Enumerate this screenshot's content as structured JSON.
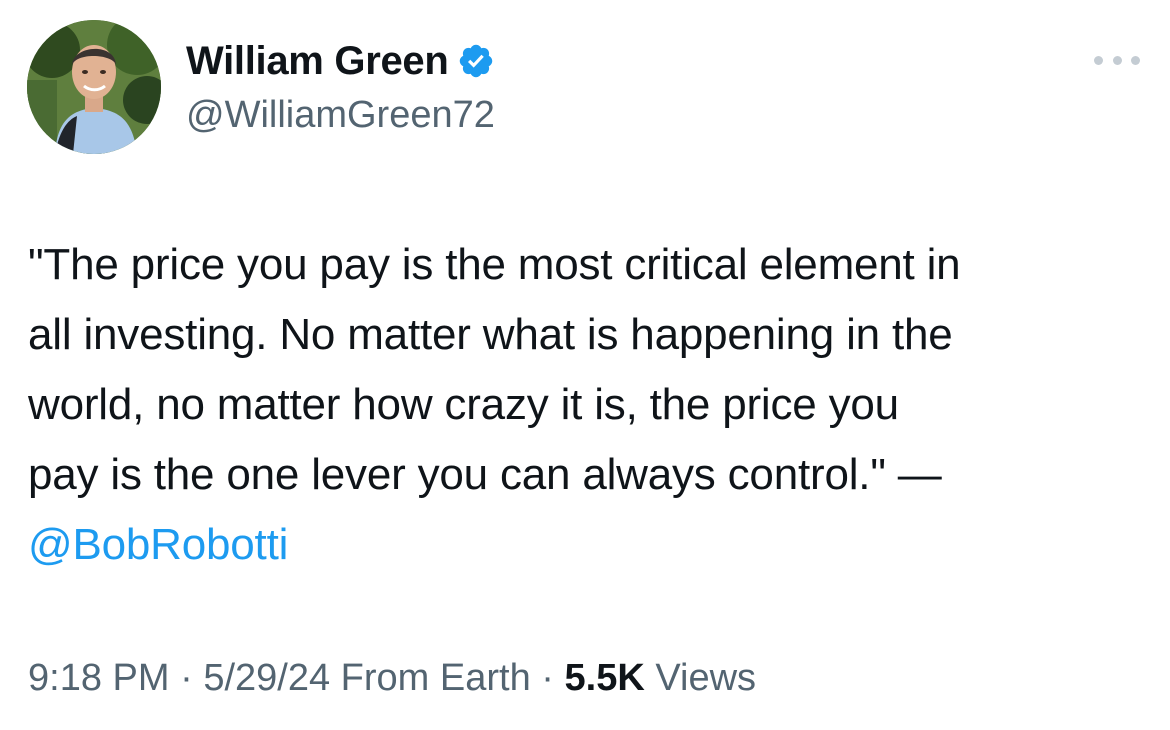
{
  "author": {
    "display_name": "William Green",
    "handle": "@WilliamGreen72",
    "verified": true,
    "avatar_icon": "avatar-photo"
  },
  "tweet": {
    "lines": [
      "\"The price you pay is the most critical element in",
      "all investing. No matter what is happening in the",
      "world, no matter how crazy it is, the price you",
      "pay is the one lever you can always control.\" —"
    ],
    "mention": "@BobRobotti"
  },
  "meta": {
    "time": "9:18 PM",
    "sep1": " · ",
    "date": "5/29/24",
    "source": "From Earth",
    "sep2": " · ",
    "views_count": "5.5K",
    "views_label": "Views"
  },
  "icons": {
    "verified": "verified-badge-icon",
    "more": "more-options-icon"
  },
  "colors": {
    "text": "#0f1419",
    "secondary": "#536471",
    "accent": "#1d9bf0"
  }
}
